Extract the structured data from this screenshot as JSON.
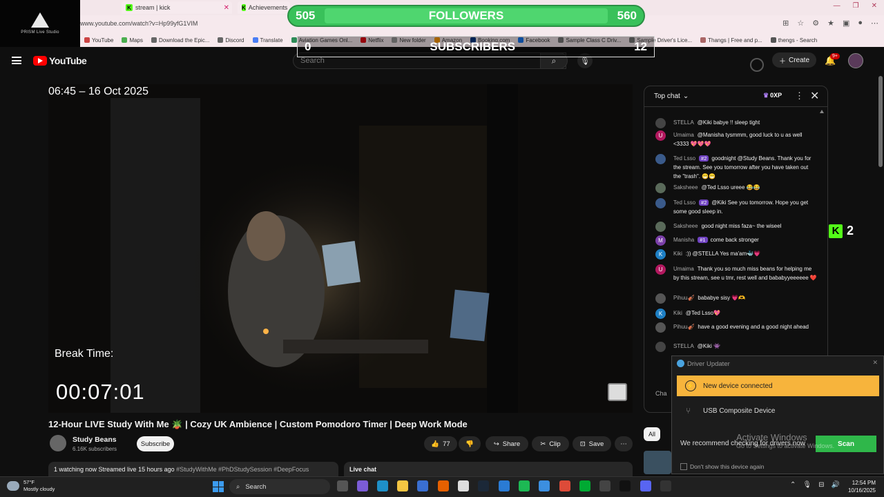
{
  "browser": {
    "tabs": [
      {
        "label": "stream | kick"
      },
      {
        "label": "Achievements"
      }
    ],
    "url": "www.youtube.com/watch?v=Hp99yfG1VIM",
    "bookmarks": [
      "YouTube",
      "Maps",
      "Download the Epic...",
      "Discord",
      "Translate",
      "Aviation Games Onl...",
      "Netflix",
      "New folder",
      "Amazon",
      "Booking.com",
      "Facebook",
      "Sample Class C Driv...",
      "Sample Driver's Lice...",
      "Thangs | Free and p...",
      "thengs - Search"
    ]
  },
  "prism": {
    "label": "PRISM Live Studio"
  },
  "overlays": {
    "followers": {
      "left": "505",
      "label": "FOLLOWERS",
      "right": "560"
    },
    "subscribers": {
      "left": "0",
      "label": "SUBSCRIBERS",
      "right": "12"
    }
  },
  "youtube": {
    "logo": "YouTube",
    "search_placeholder": "Search",
    "create_label": "Create",
    "notif_count": "9+"
  },
  "video": {
    "timestamp": "06:45 – 16 Oct 2025",
    "break_label": "Break Time:",
    "break_time": "00:07:01",
    "title": "12-Hour LIVE Study With Me 🪴 | Cozy UK Ambience | Custom Pomodoro Timer | Deep Work Mode",
    "channel": "Study Beans",
    "channel_subs": "6.16K subscribers",
    "subscribe_label": "Subscribe",
    "likes": "77",
    "share_label": "Share",
    "clip_label": "Clip",
    "save_label": "Save",
    "stats": "1 watching now  Streamed live 15 hours ago",
    "tags": "#StudyWithMe #PhDStudySession #DeepFocus",
    "live_chat_label": "Live chat",
    "all_chip": "All"
  },
  "chat": {
    "header": "Top chat",
    "xp": "0XP",
    "input_hint": "Cha",
    "messages": [
      {
        "author": "STELLA",
        "badge": "",
        "text": "@Kiki babye !! sleep tight",
        "avatar": "",
        "color": "#444"
      },
      {
        "author": "Umaima",
        "badge": "",
        "text": "@Manisha tysmmm, good luck to u as well <3333 💖💖💖",
        "avatar": "U",
        "color": "#b3185f"
      },
      {
        "author": "Ted Lsso",
        "badge": "#2",
        "text": "goodnight @Study Beans. Thank you for the stream. See you tomorrow after you have taken out the \"trash\". 😁😁",
        "avatar": "",
        "color": "#3a5a8a"
      },
      {
        "author": "Saksheee",
        "badge": "",
        "text": "@Ted Lsso ureee 😂😂",
        "avatar": "",
        "color": "#5a6a5a"
      },
      {
        "author": "Ted Lsso",
        "badge": "#2",
        "text": "@Kiki See you tomorrow. Hope you get some good sleep in.",
        "avatar": "",
        "color": "#3a5a8a"
      },
      {
        "author": "Saksheee",
        "badge": "",
        "text": "good night miss faza~ the wiseel",
        "avatar": "",
        "color": "#5a6a5a"
      },
      {
        "author": "Manisha",
        "badge": "#1",
        "text": "come back stronger",
        "avatar": "M",
        "color": "#7a3fa8"
      },
      {
        "author": "Kiki",
        "badge": "",
        "text": ":)) @STELLA Yes ma'am🐳💗",
        "avatar": "K",
        "color": "#1e7fc4"
      },
      {
        "author": "Umaima",
        "badge": "",
        "text": "Thank you so much miss beans for helping me by this stream, see u tmr, rest well and bababyyeeeeee ❤️",
        "avatar": "U",
        "color": "#b3185f"
      },
      {
        "author": "Pihuu🎻",
        "badge": "",
        "text": "bababye sisy 💗🫶",
        "avatar": "",
        "color": "#555"
      },
      {
        "author": "Kiki",
        "badge": "",
        "text": "@Ted Lsso💖",
        "avatar": "K",
        "color": "#1e7fc4"
      },
      {
        "author": "Pihuu🎻",
        "badge": "",
        "text": "have a good evening and a good night ahead",
        "avatar": "",
        "color": "#555"
      },
      {
        "author": "STELLA",
        "badge": "",
        "text": "@Kiki 👾",
        "avatar": "",
        "color": "#444"
      }
    ]
  },
  "kick_widget": {
    "value": "2"
  },
  "popup": {
    "title": "Driver Updater",
    "alert": "New device connected",
    "device": "USB Composite Device",
    "recommend": "We recommend checking for drivers now",
    "scan_label": "Scan",
    "checkbox_label": "Don't show this device again"
  },
  "activate": {
    "line1": "Activate Windows",
    "line2": "Go to Settings to activate Windows."
  },
  "taskbar": {
    "temp": "57°F",
    "weather": "Mostly cloudy",
    "search_label": "Search",
    "time": "12:54 PM",
    "date": "10/16/2025"
  }
}
